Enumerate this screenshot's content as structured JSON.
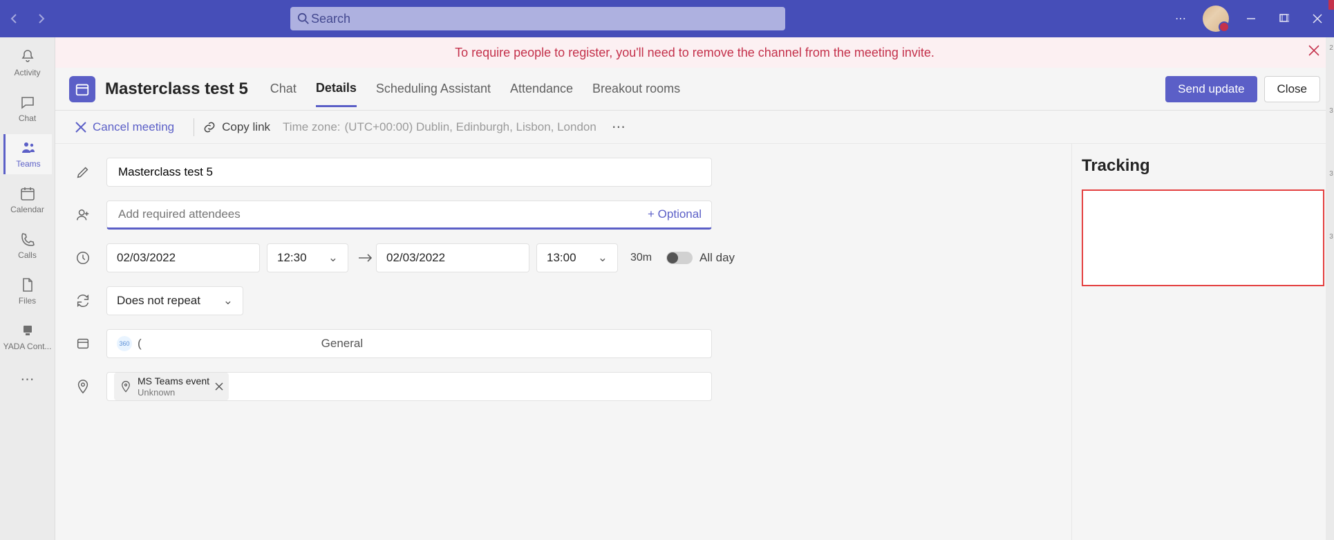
{
  "titlebar": {
    "search_placeholder": "Search"
  },
  "rail": {
    "items": [
      {
        "label": "Activity"
      },
      {
        "label": "Chat"
      },
      {
        "label": "Teams"
      },
      {
        "label": "Calendar"
      },
      {
        "label": "Calls"
      },
      {
        "label": "Files"
      },
      {
        "label": "YADA Cont..."
      }
    ]
  },
  "warning": {
    "text": "To require people to register, you'll need to remove the channel from the meeting invite."
  },
  "header": {
    "meeting_title": "Masterclass test 5",
    "tabs": {
      "chat": "Chat",
      "details": "Details",
      "sched": "Scheduling Assistant",
      "attendance": "Attendance",
      "breakout": "Breakout rooms"
    },
    "send_update": "Send update",
    "close": "Close"
  },
  "actions": {
    "cancel": "Cancel meeting",
    "copy": "Copy link",
    "tz_label": "Time zone:",
    "tz_value": "(UTC+00:00) Dublin, Edinburgh, Lisbon, London"
  },
  "form": {
    "title_value": "Masterclass test 5",
    "attendees_placeholder": "Add required attendees",
    "optional": "+ Optional",
    "start_date": "02/03/2022",
    "start_time": "12:30",
    "end_date": "02/03/2022",
    "end_time": "13:00",
    "duration": "30m",
    "all_day": "All day",
    "repeat": "Does not repeat",
    "channel": "General",
    "location_title": "MS Teams event",
    "location_sub": "Unknown"
  },
  "tracking": {
    "title": "Tracking"
  },
  "scroll_labels": {
    "a": "2",
    "b": "3",
    "c": "3",
    "d": "3"
  }
}
